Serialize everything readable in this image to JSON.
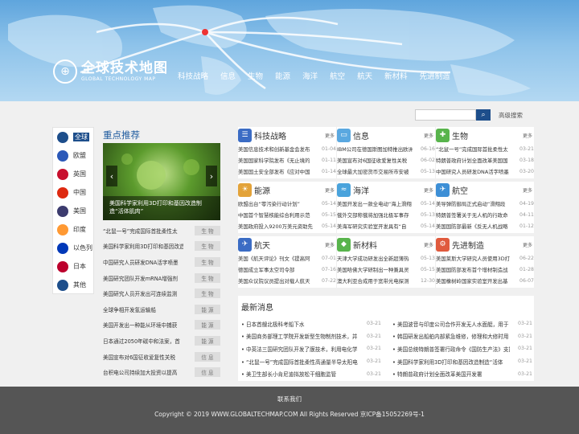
{
  "header": {
    "logo_cn": "全球技术地图",
    "logo_en": "GLOBAL TECHNOLOGY MAP",
    "nav": [
      "科技战略",
      "信息",
      "生物",
      "能源",
      "海洋",
      "航空",
      "航天",
      "新材料",
      "先进制造"
    ]
  },
  "search": {
    "placeholder": "",
    "advanced_label": "高级搜索"
  },
  "sidebar": {
    "languages": [
      {
        "label": "全球",
        "color": "#1d4e8b"
      },
      {
        "label": "欧盟",
        "color": "#2b58b8"
      },
      {
        "label": "英国",
        "color": "#c8102e"
      },
      {
        "label": "中国",
        "color": "#de2910"
      },
      {
        "label": "美国",
        "color": "#3c3b6e"
      },
      {
        "label": "印度",
        "color": "#ff9933"
      },
      {
        "label": "以色列",
        "color": "#0038b8"
      },
      {
        "label": "日本",
        "color": "#bc002d"
      },
      {
        "label": "其他",
        "color": "#1d4e8b"
      }
    ]
  },
  "recommend": {
    "title": "重点推荐",
    "caption": "美国科学家利用3D打印和基因改造制造“活体肌肉”",
    "items": [
      {
        "title": "“北鼠一号”完成国际首批柔性太",
        "tag": "生 物"
      },
      {
        "title": "美国科学家利用3D打印和基因改造",
        "tag": "生 物"
      },
      {
        "title": "中国研究人员研发DNA活字喷墨",
        "tag": "生 物"
      },
      {
        "title": "美国研究团队开发mRNA增强剂",
        "tag": "生 物"
      },
      {
        "title": "美国研究人员开发出可连续监测",
        "tag": "生 物"
      },
      {
        "title": "全球争相开发氢运输船",
        "tag": "能 源"
      },
      {
        "title": "美国开发出一种能从环境中捕获",
        "tag": "能 源"
      },
      {
        "title": "日本通过2050年碳中和法案，首",
        "tag": "能 源"
      },
      {
        "title": "美国宣布对6国征收爱复性关税",
        "tag": "信 息"
      },
      {
        "title": "台积电公司持续加大投资以提高",
        "tag": "信 息"
      }
    ]
  },
  "cards": [
    {
      "name": "科技战略",
      "icon": "☰",
      "color": "#3b6cc4",
      "more": "更多",
      "rows": [
        {
          "t": "美国信息技术和创新基金会发布",
          "d": "01-04"
        },
        {
          "t": "美国国家科学院发布《无止境的",
          "d": "01-11"
        },
        {
          "t": "美国国土安全部发布《应对中国",
          "d": "01-14"
        }
      ]
    },
    {
      "name": "信息",
      "icon": "▭",
      "color": "#5aa8e0",
      "more": "更多",
      "rows": [
        {
          "t": "IBM公司在德国斯图加特推出欧洲",
          "d": "06-16"
        },
        {
          "t": "美国宣布对6国征收爱复性关税",
          "d": "06-02"
        },
        {
          "t": "全球最大加密货币交易所市安被",
          "d": "05-13"
        }
      ]
    },
    {
      "name": "生物",
      "icon": "✚",
      "color": "#58b44c",
      "more": "更多",
      "rows": [
        {
          "t": "“北鼠一号”完成国际首批柔性太",
          "d": "03-21"
        },
        {
          "t": "特朗普政府计划全面改革美国国",
          "d": "03-18"
        },
        {
          "t": "中国研究人员研发DNA活字喷墨",
          "d": "03-20"
        }
      ]
    },
    {
      "name": "能源",
      "icon": "☀",
      "color": "#e3a33a",
      "more": "更多",
      "rows": [
        {
          "t": "欧盟出台“零污染行动计划”",
          "d": "05-14"
        },
        {
          "t": "中国首个智慧核能综合利用示范",
          "d": "05-15"
        },
        {
          "t": "美国政府投入9200万美元资助先",
          "d": "05-14"
        }
      ]
    },
    {
      "name": "海洋",
      "icon": "≈",
      "color": "#4aa3dc",
      "more": "更多",
      "rows": [
        {
          "t": "美国开发出一款全电动“海上滑翔",
          "d": "05-14"
        },
        {
          "t": "俄外交部称俄将加强北极军事存",
          "d": "05-13"
        },
        {
          "t": "美海军研究实验室开发具有“自",
          "d": "05-14"
        }
      ]
    },
    {
      "name": "航空",
      "icon": "✈",
      "color": "#3d8fd6",
      "more": "更多",
      "rows": [
        {
          "t": "美导弹防御局正式启动“滑翔段",
          "d": "04-19"
        },
        {
          "t": "特朗普签署关于无人机的行政命",
          "d": "04-11"
        },
        {
          "t": "美国国防部最新《反无人机战略",
          "d": "01-12"
        }
      ]
    },
    {
      "name": "航天",
      "icon": "✈",
      "color": "#3b6cc4",
      "more": "更多",
      "rows": [
        {
          "t": "美国《航天评论》刊文《提高阿",
          "d": "07-01"
        },
        {
          "t": "德国成立军事太空司令部",
          "d": "07-16"
        },
        {
          "t": "美国众议院议员提出对载人航天",
          "d": "07-22"
        }
      ]
    },
    {
      "name": "新材料",
      "icon": "◆",
      "color": "#58b44c",
      "more": "更多",
      "rows": [
        {
          "t": "天津大学成功研发出全新超薄热",
          "d": "05-13"
        },
        {
          "t": "美国哈佛大学研制出一种兼具灵",
          "d": "05-15"
        },
        {
          "t": "澳大利亚合成用于宽带光电探测",
          "d": "12-30"
        }
      ]
    },
    {
      "name": "先进制造",
      "icon": "⚙",
      "color": "#e05a3d",
      "more": "更多",
      "rows": [
        {
          "t": "美国莱斯大学研究人员使用3D打",
          "d": "06-22"
        },
        {
          "t": "美国国防部发布首个增材制造战",
          "d": "01-28"
        },
        {
          "t": "美国橡树岭国家实验室开发出基",
          "d": "06-07"
        }
      ]
    }
  ],
  "latest": {
    "title": "最新消息",
    "left": [
      {
        "t": "日本首艘北极科考船下水",
        "d": "03-21"
      },
      {
        "t": "美国商务部理工学院开发新型生物制剂技术，并",
        "d": "03-21"
      },
      {
        "t": "中英法三国研究团队开发了膜技术，利用电化学",
        "d": "03-21"
      },
      {
        "t": "“北鼠一号”完成国际首批柔性高通量半导太阳电",
        "d": "03-21"
      },
      {
        "t": "美卫生部长小肯尼迪拟放松干细胞监管",
        "d": "03-21"
      }
    ],
    "right": [
      {
        "t": "美国波音与印度公司合作开发无人水面艇，用于",
        "d": "03-21"
      },
      {
        "t": "韩国研发出船舶内部紧急维修，修理和大修时用",
        "d": "03-21"
      },
      {
        "t": "美国总统特朗普签署行政命令《国防生产法》支持",
        "d": "03-21"
      },
      {
        "t": "美国科学家利用3D打印和基因改造制造“活体",
        "d": "03-21"
      },
      {
        "t": "特朗普政府计划全面改革美国开发署",
        "d": "03-21"
      }
    ]
  },
  "footer": {
    "contact": "联系我们",
    "copyright": "Copyright © 2019 WWW.GLOBALTECHMAP.COM All Rights Reserved 京ICP备15052269号-1"
  }
}
